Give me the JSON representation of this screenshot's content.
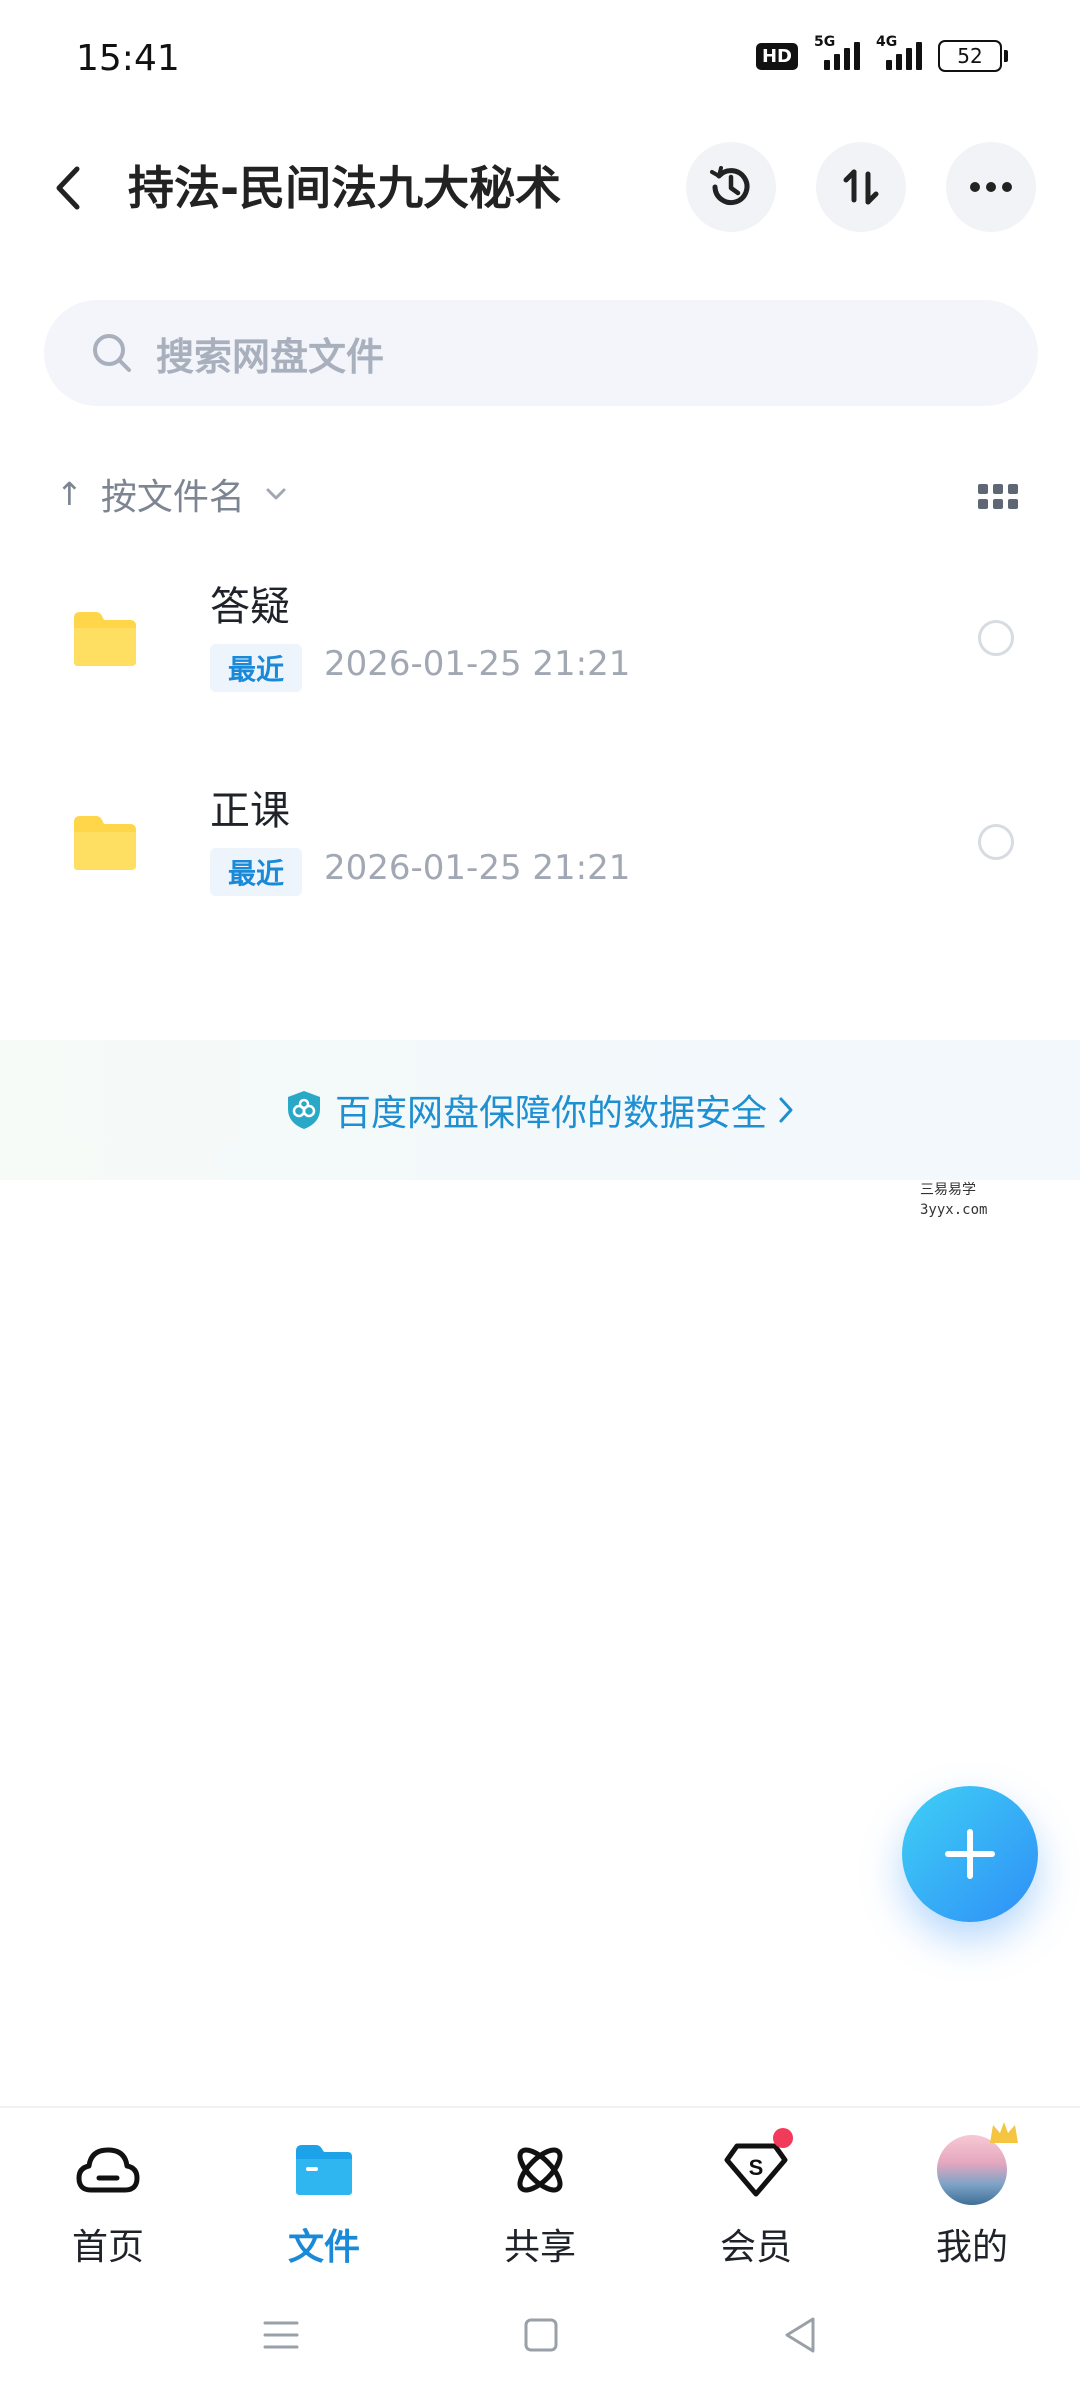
{
  "status_bar": {
    "time": "15:41",
    "hd": "HD",
    "net1": "5G",
    "net2": "4G",
    "battery": "52"
  },
  "header": {
    "title": "持法-民间法九大秘术"
  },
  "search": {
    "placeholder": "搜索网盘文件"
  },
  "sort": {
    "arrow": "↑",
    "label": "按文件名"
  },
  "files": [
    {
      "name": "答疑",
      "badge": "最近",
      "date": "2026-01-25  21:21"
    },
    {
      "name": "正课",
      "badge": "最近",
      "date": "2026-01-25  21:21"
    }
  ],
  "security_banner": {
    "text": "百度网盘保障你的数据安全"
  },
  "watermark": {
    "line1": "三易易学",
    "line2": "3yyx.com"
  },
  "bottom_nav": {
    "items": [
      {
        "label": "首页",
        "icon": "home-cloud-icon"
      },
      {
        "label": "文件",
        "icon": "folder-icon"
      },
      {
        "label": "共享",
        "icon": "share-atom-icon"
      },
      {
        "label": "会员",
        "icon": "vip-diamond-icon"
      },
      {
        "label": "我的",
        "icon": "avatar"
      }
    ],
    "active_index": 1
  },
  "colors": {
    "accent": "#1a8ad8",
    "folder": "#ffd54a",
    "fab_start": "#3fd0f6",
    "fab_end": "#2f8ff6",
    "badge_dot": "#f23a5a"
  }
}
